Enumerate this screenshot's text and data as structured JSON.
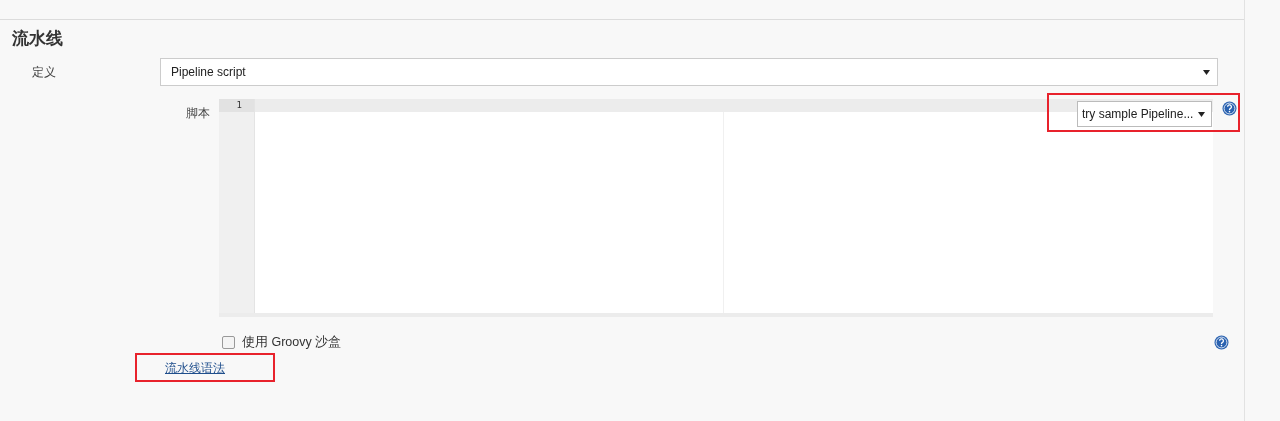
{
  "section": {
    "title": "流水线"
  },
  "definition": {
    "label": "定义",
    "value": "Pipeline script"
  },
  "script": {
    "label": "脚本",
    "line_numbers": [
      "1"
    ],
    "sample_dropdown": {
      "value": "try sample Pipeline...",
      "highlighted": true
    }
  },
  "sandbox": {
    "label": "使用 Groovy 沙盒",
    "checked": false
  },
  "syntax_link": {
    "label": "流水线语法",
    "highlighted": true
  }
}
